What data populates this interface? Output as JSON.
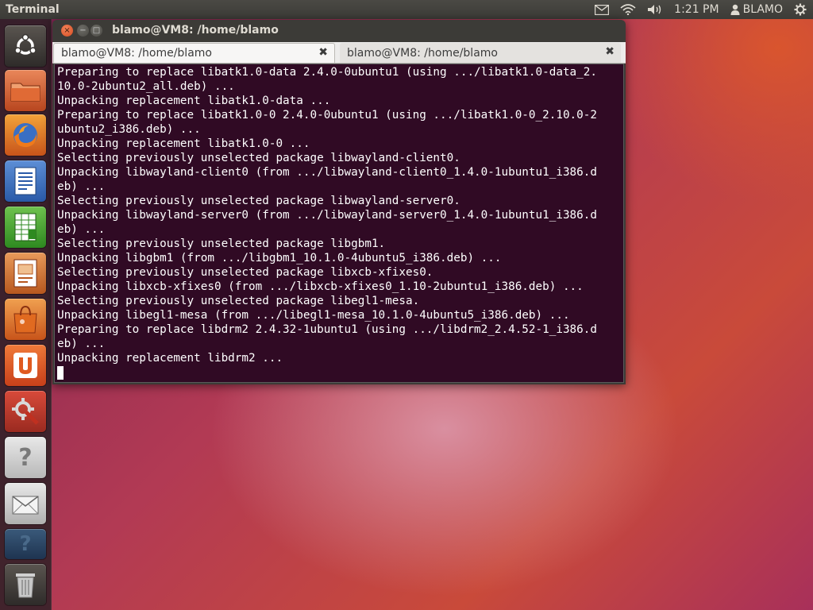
{
  "top_panel": {
    "app_title": "Terminal",
    "indicators": {
      "mail_icon": "envelope-icon",
      "network_icon": "wifi-icon",
      "sound_icon": "speaker-icon",
      "clock": "1:21 PM",
      "user_icon": "person-icon",
      "user_name": "BLAMO",
      "session_icon": "gear-icon"
    }
  },
  "launcher": {
    "items": [
      {
        "name": "ubuntu-dash",
        "icon": "ubuntu-logo-icon"
      },
      {
        "name": "files",
        "icon": "folder-icon"
      },
      {
        "name": "firefox",
        "icon": "firefox-icon"
      },
      {
        "name": "writer",
        "icon": "document-icon"
      },
      {
        "name": "calc",
        "icon": "spreadsheet-icon"
      },
      {
        "name": "impress",
        "icon": "presentation-icon"
      },
      {
        "name": "software-center",
        "icon": "shopping-bag-icon"
      },
      {
        "name": "ubuntu-one",
        "icon": "ubuntu-one-icon"
      },
      {
        "name": "system-settings",
        "icon": "settings-icon"
      },
      {
        "name": "unknown-app",
        "icon": "question-icon"
      },
      {
        "name": "mail-app",
        "icon": "envelope-icon"
      },
      {
        "name": "unknown-app-2",
        "icon": "question-icon"
      },
      {
        "name": "trash",
        "icon": "trash-icon"
      }
    ],
    "unknown_glyph": "?"
  },
  "window": {
    "title": "blamo@VM8: /home/blamo",
    "close_glyph": "×",
    "minimize_glyph": "−",
    "maximize_glyph": "□",
    "tabs": [
      {
        "label": "blamo@VM8: /home/blamo",
        "active": true
      },
      {
        "label": "blamo@VM8: /home/blamo",
        "active": false
      }
    ],
    "tab_close_glyph": "✖"
  },
  "terminal": {
    "lines": [
      "Preparing to replace libatk1.0-data 2.4.0-0ubuntu1 (using .../libatk1.0-data_2.",
      "10.0-2ubuntu2_all.deb) ...",
      "Unpacking replacement libatk1.0-data ...",
      "Preparing to replace libatk1.0-0 2.4.0-0ubuntu1 (using .../libatk1.0-0_2.10.0-2",
      "ubuntu2_i386.deb) ...",
      "Unpacking replacement libatk1.0-0 ...",
      "Selecting previously unselected package libwayland-client0.",
      "Unpacking libwayland-client0 (from .../libwayland-client0_1.4.0-1ubuntu1_i386.d",
      "eb) ...",
      "Selecting previously unselected package libwayland-server0.",
      "Unpacking libwayland-server0 (from .../libwayland-server0_1.4.0-1ubuntu1_i386.d",
      "eb) ...",
      "Selecting previously unselected package libgbm1.",
      "Unpacking libgbm1 (from .../libgbm1_10.1.0-4ubuntu5_i386.deb) ...",
      "Selecting previously unselected package libxcb-xfixes0.",
      "Unpacking libxcb-xfixes0 (from .../libxcb-xfixes0_1.10-2ubuntu1_i386.deb) ...",
      "Selecting previously unselected package libegl1-mesa.",
      "Unpacking libegl1-mesa (from .../libegl1-mesa_10.1.0-4ubuntu5_i386.deb) ...",
      "Preparing to replace libdrm2 2.4.32-1ubuntu1 (using .../libdrm2_2.4.52-1_i386.d",
      "eb) ...",
      "Unpacking replacement libdrm2 ..."
    ]
  },
  "colors": {
    "terminal_bg": "#300a24",
    "terminal_fg": "#ffffff",
    "panel_bg": "#3c3b37",
    "close_button": "#e05a2b"
  }
}
